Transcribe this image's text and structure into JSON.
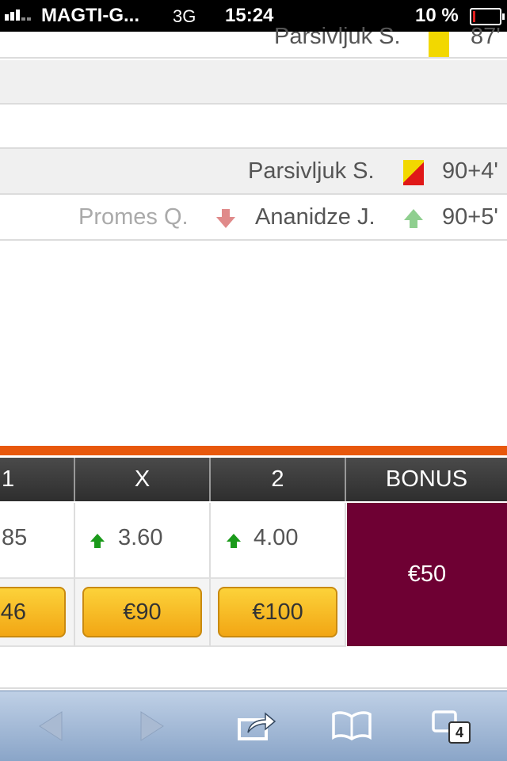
{
  "status_bar": {
    "carrier": "MAGTI-G...",
    "network": "3G",
    "time": "15:24",
    "battery": "10 %",
    "battery_level": 0.1
  },
  "events": [
    {
      "player": "Parsivljuk S.",
      "card": "yellow",
      "minute": "87'"
    },
    {
      "player": "Parsivljuk S.",
      "card": "second-yellow-red",
      "minute": "90+4'"
    },
    {
      "player_out": "Promes Q.",
      "player_in": "Ananidze J.",
      "minute": "90+5'"
    }
  ],
  "odds_table": {
    "headers": [
      "1",
      "X",
      "2",
      "BONUS"
    ],
    "odds": [
      {
        "value": "85",
        "arrow": ""
      },
      {
        "value": "3.60",
        "arrow": "up"
      },
      {
        "value": "4.00",
        "arrow": "up"
      }
    ],
    "buttons": [
      "46",
      "€90",
      "€100"
    ],
    "bonus": "€50"
  },
  "toolbar": {
    "icons": [
      "back-icon",
      "forward-icon",
      "share-icon",
      "bookmarks-icon",
      "tabs-icon"
    ],
    "tab_count": "4"
  },
  "colors": {
    "orange": "#e8580c",
    "bonus_bg": "#6e0033",
    "button": "#f2a614",
    "toolbar": "#9fb6d4"
  }
}
